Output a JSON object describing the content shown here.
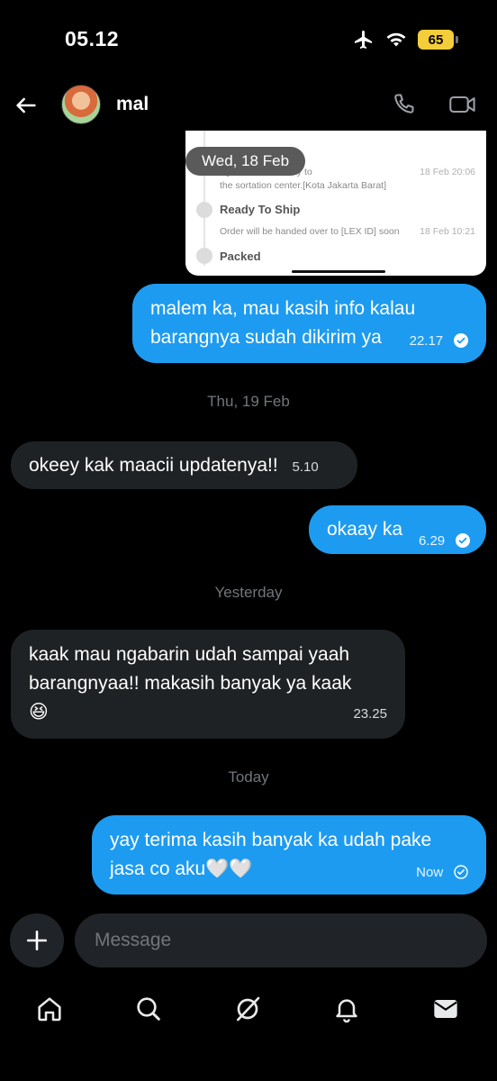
{
  "status_bar": {
    "time": "05.12",
    "battery": "65"
  },
  "header": {
    "contact_name": "mal"
  },
  "attachment": {
    "line1": "D] and is on its way to",
    "line1_time": "18 Feb 20:06",
    "line2": "the sortation center.[Kota Jakarta Barat]",
    "step1_title": "Ready To Ship",
    "step1_desc": "Order will be handed over to [LEX ID] soon",
    "step1_time": "18 Feb 10:21",
    "step2_title": "Packed",
    "date_chip": "Wed, 18 Feb"
  },
  "messages": [
    {
      "dir": "out",
      "lines": [
        "malem ka, mau kasih info kalau",
        "barangnya sudah dikirim ya"
      ],
      "time": "22.17"
    },
    {
      "separator": "Thu, 19 Feb"
    },
    {
      "dir": "in",
      "text": "okeey kak maacii updatenya!!",
      "time": "5.10"
    },
    {
      "dir": "out",
      "text": "okaay ka",
      "time": "6.29"
    },
    {
      "separator": "Yesterday"
    },
    {
      "dir": "in",
      "lines": [
        "kaak mau ngabarin udah sampai yaah",
        "barangnyaa!! makasih banyak ya kaak",
        "😆"
      ],
      "time": "23.25"
    },
    {
      "separator": "Today"
    },
    {
      "dir": "out",
      "lines": [
        "yay terima kasih banyak ka udah pake",
        "jasa co aku🤍🤍"
      ],
      "time": "Now"
    }
  ],
  "composer": {
    "placeholder": "Message"
  },
  "nav": [
    "home-icon",
    "search-icon",
    "grok-icon",
    "notifications-icon",
    "messages-icon"
  ]
}
